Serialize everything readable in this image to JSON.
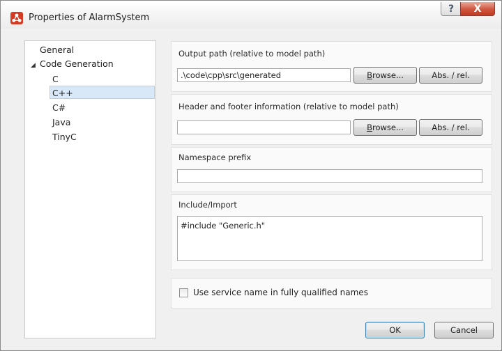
{
  "window": {
    "title": "Properties of AlarmSystem",
    "help_symbol": "?",
    "close_symbol": "X"
  },
  "tree": {
    "items": [
      {
        "label": "General"
      },
      {
        "label": "Code Generation"
      },
      {
        "label": "C"
      },
      {
        "label": "C++"
      },
      {
        "label": "C#"
      },
      {
        "label": "Java"
      },
      {
        "label": "TinyC"
      }
    ],
    "expander_symbol": "◢"
  },
  "output_path": {
    "label": "Output path (relative to model path)",
    "value": ".\\code\\cpp\\src\\generated",
    "browse_label": "rowse...",
    "browse_accel": "B",
    "absrel_label": "Abs. / rel."
  },
  "header_footer": {
    "label": "Header and footer information (relative to model path)",
    "value": "",
    "browse_label": "rowse...",
    "browse_accel": "B",
    "absrel_label": "Abs. / rel."
  },
  "namespace": {
    "label": "Namespace prefix",
    "value": ""
  },
  "include": {
    "label": "Include/Import",
    "value": "#include \"Generic.h\""
  },
  "service_name": {
    "label": "Use service name in fully qualified names",
    "checked": false
  },
  "footer": {
    "ok_label": "OK",
    "cancel_label": "Cancel"
  }
}
